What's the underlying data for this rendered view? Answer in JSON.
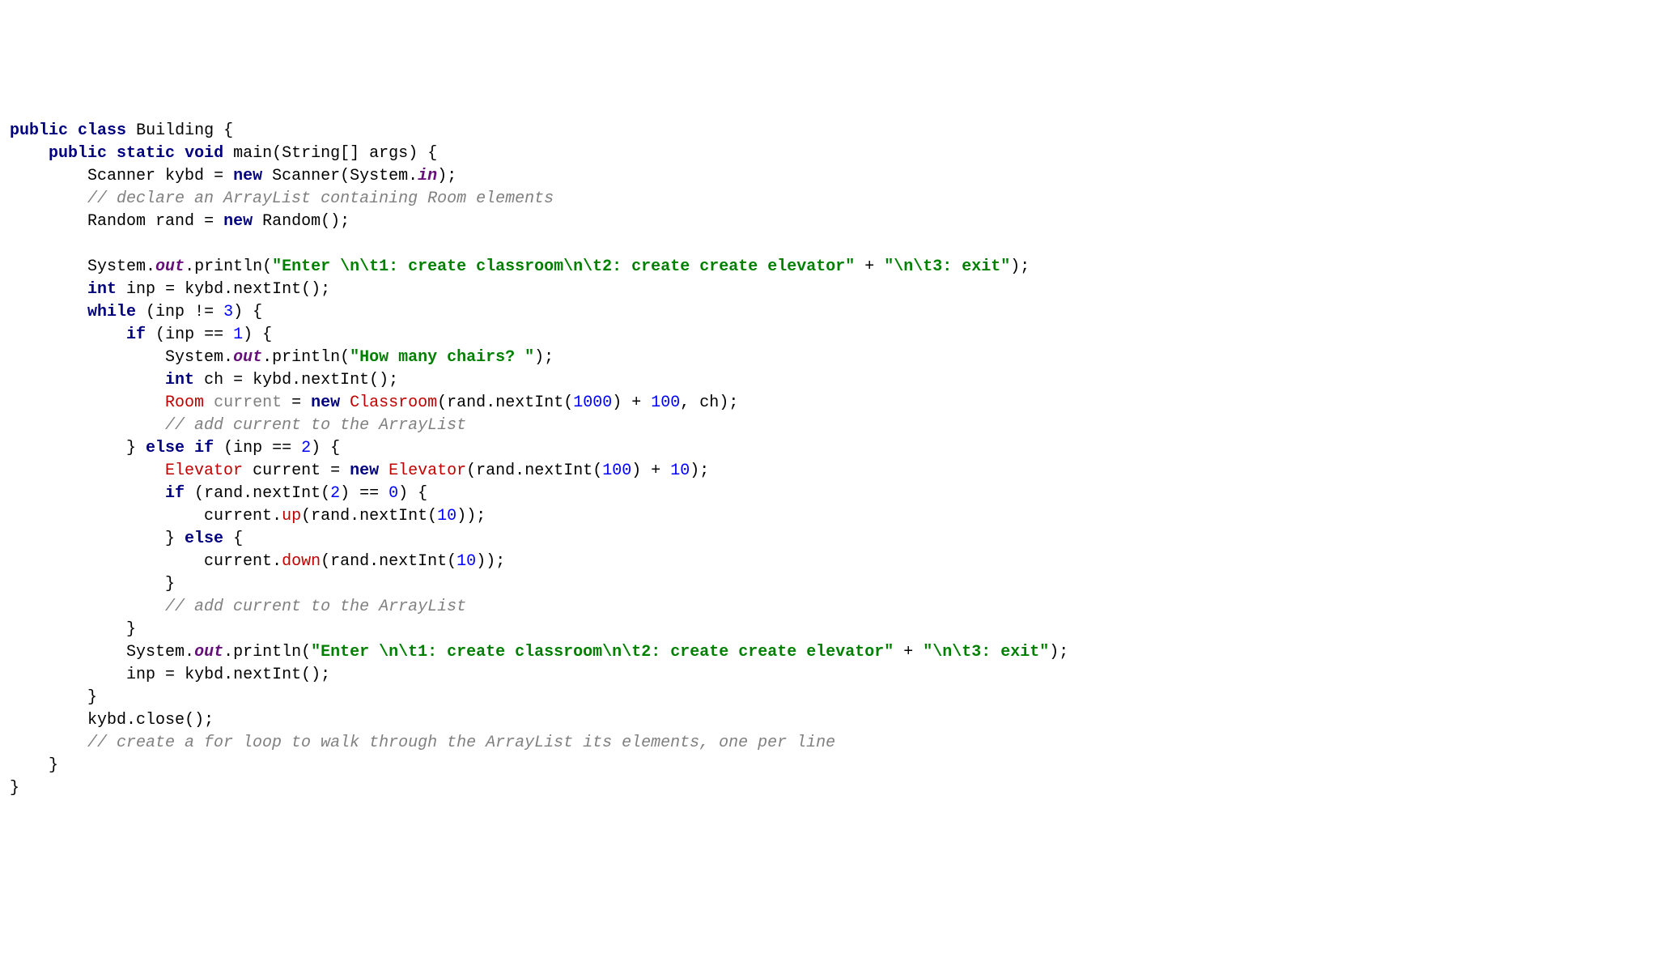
{
  "t": {
    "kw_public": "public",
    "kw_class": "class",
    "kw_static": "static",
    "kw_void": "void",
    "kw_new": "new",
    "kw_int": "int",
    "kw_while": "while",
    "kw_if": "if",
    "kw_else": "else",
    "name_Building": "Building",
    "name_main": "main",
    "name_String": "String",
    "name_args": "args",
    "name_Scanner": "Scanner",
    "name_kybd": "kybd",
    "name_System": "System",
    "field_in": "in",
    "field_out": "out",
    "name_Random": "Random",
    "name_rand": "rand",
    "name_println": "println",
    "name_nextInt": "nextInt",
    "name_inp": "inp",
    "name_ch": "ch",
    "type_Room": "Room",
    "type_Classroom": "Classroom",
    "type_Elevator": "Elevator",
    "name_current": "current",
    "name_up": "up",
    "name_down": "down",
    "name_close": "close",
    "str_menu1": "\"Enter \\n\\t1: create classroom\\n\\t2: create create elevator\"",
    "str_menu2": "\"\\n\\t3: exit\"",
    "str_chairs": "\"How many chairs? \"",
    "num_3": "3",
    "num_1": "1",
    "num_2": "2",
    "num_0": "0",
    "num_1000": "1000",
    "num_100": "100",
    "num_10": "10",
    "comment_decl": "// declare an ArrayList containing Room elements",
    "comment_add1": "// add current to the ArrayList",
    "comment_add2": "// add current to the ArrayList",
    "comment_loop": "// create a for loop to walk through the ArrayList its elements, one per line"
  }
}
